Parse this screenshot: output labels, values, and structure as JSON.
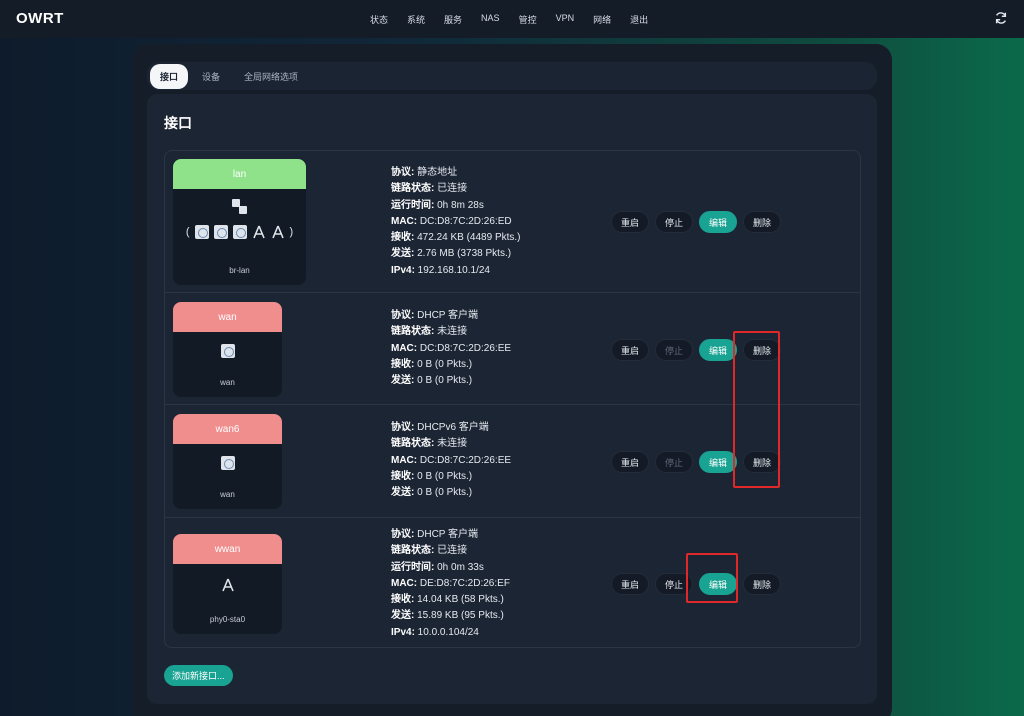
{
  "app": {
    "brand": "OWRT"
  },
  "nav": [
    "状态",
    "系统",
    "服务",
    "NAS",
    "管控",
    "VPN",
    "网络",
    "退出"
  ],
  "tabs": [
    "接口",
    "设备",
    "全局网络选项"
  ],
  "content": {
    "title": "接口",
    "add_button": "添加新接口..."
  },
  "buttons": {
    "restart": "重启",
    "stop": "停止",
    "edit": "编辑",
    "delete": "删除"
  },
  "interfaces": [
    {
      "name": "lan",
      "status_color": "#8fe28a",
      "device": "br-lan",
      "info": [
        {
          "k": "协议:",
          "v": " 静态地址"
        },
        {
          "k": "链路状态:",
          "v": " 已连接"
        },
        {
          "k": "运行时间:",
          "v": " 0h 8m 28s"
        },
        {
          "k": "MAC:",
          "v": " DC:D8:7C:2D:26:ED"
        },
        {
          "k": "接收:",
          "v": " 472.24 KB (4489 Pkts.)"
        },
        {
          "k": "发送:",
          "v": " 2.76 MB (3738 Pkts.)"
        },
        {
          "k": "IPv4:",
          "v": " 192.168.10.1/24"
        }
      ],
      "stop_disabled": false
    },
    {
      "name": "wan",
      "status_color": "#f08e8e",
      "device": "wan",
      "info": [
        {
          "k": "协议:",
          "v": " DHCP 客户端"
        },
        {
          "k": "链路状态:",
          "v": " 未连接"
        },
        {
          "k": "MAC:",
          "v": " DC:D8:7C:2D:26:EE"
        },
        {
          "k": "接收:",
          "v": " 0 B (0 Pkts.)"
        },
        {
          "k": "发送:",
          "v": " 0 B (0 Pkts.)"
        }
      ],
      "stop_disabled": true
    },
    {
      "name": "wan6",
      "status_color": "#f08e8e",
      "device": "wan",
      "info": [
        {
          "k": "协议:",
          "v": " DHCPv6 客户端"
        },
        {
          "k": "链路状态:",
          "v": " 未连接"
        },
        {
          "k": "MAC:",
          "v": " DC:D8:7C:2D:26:EE"
        },
        {
          "k": "接收:",
          "v": " 0 B (0 Pkts.)"
        },
        {
          "k": "发送:",
          "v": " 0 B (0 Pkts.)"
        }
      ],
      "stop_disabled": true
    },
    {
      "name": "wwan",
      "status_color": "#f08e8e",
      "device": "phy0-sta0",
      "info": [
        {
          "k": "协议:",
          "v": " DHCP 客户端"
        },
        {
          "k": "链路状态:",
          "v": " 已连接"
        },
        {
          "k": "运行时间:",
          "v": " 0h 0m 33s"
        },
        {
          "k": "MAC:",
          "v": " DE:D8:7C:2D:26:EF"
        },
        {
          "k": "接收:",
          "v": " 14.04 KB (58 Pkts.)"
        },
        {
          "k": "发送:",
          "v": " 15.89 KB (95 Pkts.)"
        },
        {
          "k": "IPv4:",
          "v": " 10.0.0.104/24"
        }
      ],
      "stop_disabled": false
    }
  ]
}
